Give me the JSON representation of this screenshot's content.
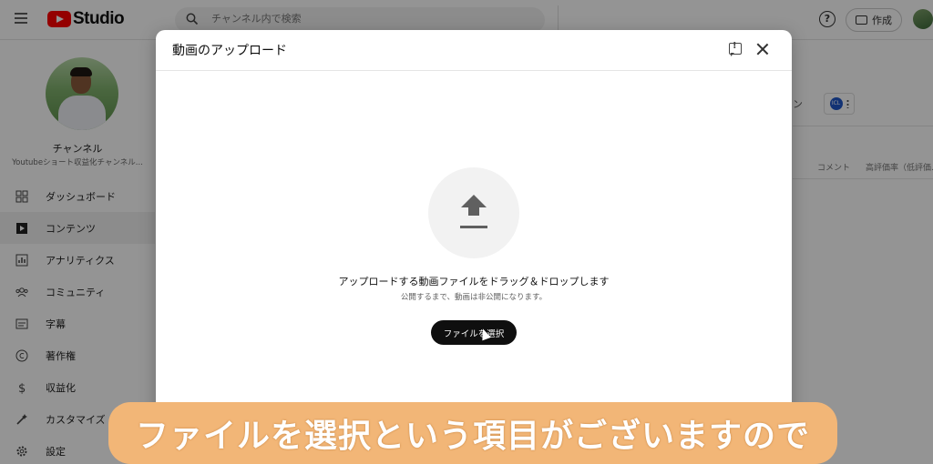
{
  "app": {
    "logo_text": "Studio"
  },
  "search": {
    "placeholder": "チャンネル内で検索"
  },
  "header": {
    "help_label": "?",
    "create_label": "作成"
  },
  "channel": {
    "name": "チャンネル",
    "subtitle": "Youtubeショート収益化チャンネル..."
  },
  "sidebar": {
    "items": [
      {
        "label": "ダッシュボード",
        "icon": "dashboard-icon"
      },
      {
        "label": "コンテンツ",
        "icon": "content-icon",
        "active": true
      },
      {
        "label": "アナリティクス",
        "icon": "analytics-icon"
      },
      {
        "label": "コミュニティ",
        "icon": "community-icon"
      },
      {
        "label": "字幕",
        "icon": "subtitles-icon"
      },
      {
        "label": "著作権",
        "icon": "copyright-icon"
      },
      {
        "label": "収益化",
        "icon": "monetization-icon"
      },
      {
        "label": "カスタマイズ",
        "icon": "customize-icon"
      },
      {
        "label": "設定",
        "icon": "settings-icon"
      }
    ]
  },
  "background": {
    "tab_fragment": "ン",
    "filter_badge": "ICL",
    "columns": [
      "コメント",
      "高評価率（低評価..."
    ]
  },
  "dialog": {
    "title": "動画のアップロード",
    "drop_main": "アップロードする動画ファイルをドラッグ＆ドロップします",
    "drop_sub": "公開するまで、動画は非公開になります。",
    "select_button": "ファイルを選択"
  },
  "caption": {
    "text": "ファイルを選択という項目がございますので"
  }
}
